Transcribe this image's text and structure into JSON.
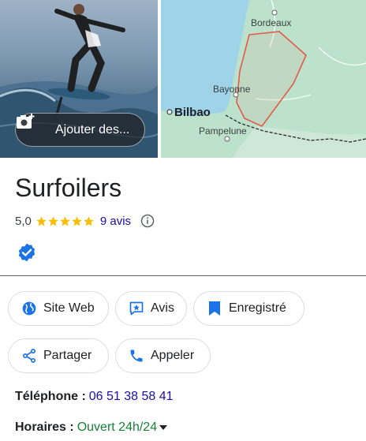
{
  "media": {
    "add_photo_label": "Ajouter des...",
    "map_labels": {
      "bordeaux": "Bordeaux",
      "bayonne": "Bayonne",
      "bilbao": "Bilbao",
      "pampelune": "Pampelune"
    }
  },
  "business": {
    "name": "Surfoilers",
    "rating": "5,0",
    "stars": 5,
    "reviews_label": "9 avis",
    "verified": true
  },
  "actions": {
    "website": "Site Web",
    "reviews": "Avis",
    "saved": "Enregistré",
    "share": "Partager",
    "call": "Appeler"
  },
  "details": {
    "phone_label": "Téléphone :",
    "phone_value": "06 51 38 58 41",
    "hours_label": "Horaires :",
    "hours_value": "Ouvert 24h/24"
  },
  "colors": {
    "star": "#fbbc04",
    "link": "#1a0dab",
    "open": "#188038",
    "saved_blue": "#1a73e8",
    "map_land": "#bde2cc",
    "map_sea": "#9ed3e8",
    "region_outline": "#e35a4a"
  }
}
